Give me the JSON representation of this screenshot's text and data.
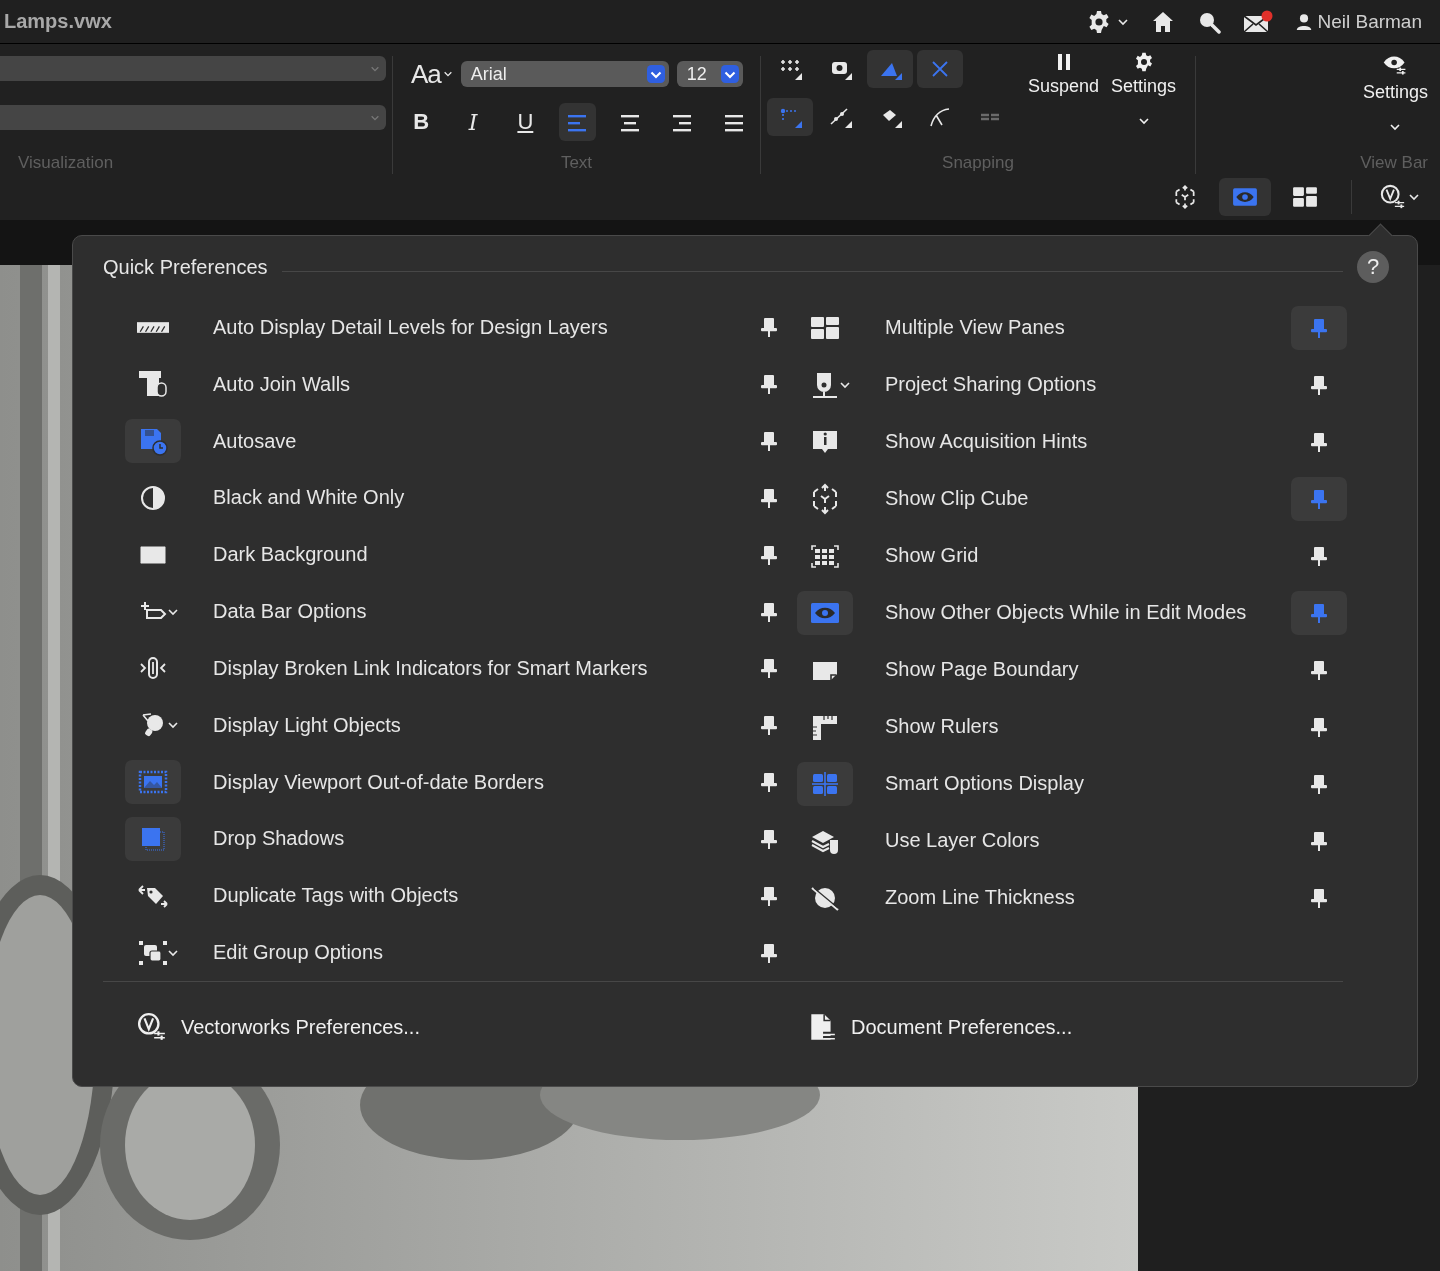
{
  "title_bar": {
    "title": "Lamps.vwx",
    "user": "Neil Barman"
  },
  "toolbar": {
    "visualization": {
      "label": "Visualization",
      "dropdowns": [
        {
          "kind": "select"
        },
        {
          "kind": "select"
        }
      ]
    },
    "text": {
      "label": "Text",
      "font_button": "Aa",
      "font": "Arial",
      "size": "12",
      "styles": [
        {
          "label": "B",
          "kind": "bold"
        },
        {
          "label": "I",
          "kind": "italic"
        },
        {
          "label": "U",
          "kind": "underline"
        }
      ],
      "alignments": [
        {
          "selected": true
        },
        {
          "selected": false
        },
        {
          "selected": false
        },
        {
          "selected": false
        }
      ]
    },
    "snapping": {
      "label": "Snapping",
      "tools": [
        {
          "selected": false,
          "disabled": false
        },
        {
          "selected": false,
          "disabled": false
        },
        {
          "selected": true,
          "disabled": false
        },
        {
          "selected": true,
          "disabled": false
        },
        {
          "selected": true,
          "disabled": false
        },
        {
          "selected": false,
          "disabled": false
        },
        {
          "selected": false,
          "disabled": false
        },
        {
          "selected": false,
          "disabled": false
        },
        {
          "selected": false,
          "disabled": true
        }
      ],
      "suspend": "Suspend",
      "settings": "Settings"
    },
    "view_bar": {
      "label": "View Bar",
      "settings": "Settings"
    },
    "view_tools": [
      {
        "selected": false
      },
      {
        "selected": true
      },
      {
        "selected": false
      }
    ]
  },
  "popup": {
    "title": "Quick Preferences",
    "help": "?",
    "items_left": [
      {
        "label": "Auto Display Detail Levels for Design Layers",
        "on": false,
        "pinned": false,
        "has_menu": false
      },
      {
        "label": "Auto Join Walls",
        "on": false,
        "pinned": false,
        "has_menu": false
      },
      {
        "label": "Autosave",
        "on": true,
        "pinned": false,
        "has_menu": false
      },
      {
        "label": "Black and White Only",
        "on": false,
        "pinned": false,
        "has_menu": false
      },
      {
        "label": "Dark Background",
        "on": false,
        "pinned": false,
        "has_menu": false
      },
      {
        "label": "Data Bar Options",
        "on": false,
        "pinned": false,
        "has_menu": true
      },
      {
        "label": "Display Broken Link Indicators for Smart Markers",
        "on": false,
        "pinned": false,
        "has_menu": false
      },
      {
        "label": "Display Light Objects",
        "on": false,
        "pinned": false,
        "has_menu": true
      },
      {
        "label": "Display Viewport Out-of-date Borders",
        "on": true,
        "pinned": false,
        "has_menu": false
      },
      {
        "label": "Drop Shadows",
        "on": true,
        "pinned": false,
        "has_menu": false
      },
      {
        "label": "Duplicate Tags with Objects",
        "on": false,
        "pinned": false,
        "has_menu": false
      },
      {
        "label": "Edit Group Options",
        "on": false,
        "pinned": false,
        "has_menu": true
      }
    ],
    "items_right": [
      {
        "label": "Multiple View Panes",
        "on": false,
        "pinned": true,
        "has_menu": false
      },
      {
        "label": "Project Sharing Options",
        "on": false,
        "pinned": false,
        "has_menu": true
      },
      {
        "label": "Show Acquisition Hints",
        "on": false,
        "pinned": false,
        "has_menu": false
      },
      {
        "label": "Show Clip Cube",
        "on": false,
        "pinned": true,
        "has_menu": false
      },
      {
        "label": "Show Grid",
        "on": false,
        "pinned": false,
        "has_menu": false
      },
      {
        "label": "Show Other Objects While in Edit Modes",
        "on": true,
        "pinned": true,
        "has_menu": false
      },
      {
        "label": "Show Page Boundary",
        "on": false,
        "pinned": false,
        "has_menu": false
      },
      {
        "label": "Show Rulers",
        "on": false,
        "pinned": false,
        "has_menu": false
      },
      {
        "label": "Smart Options Display",
        "on": true,
        "pinned": false,
        "has_menu": false
      },
      {
        "label": "Use Layer Colors",
        "on": false,
        "pinned": false,
        "has_menu": false
      },
      {
        "label": "Zoom Line Thickness",
        "on": false,
        "pinned": false,
        "has_menu": false
      }
    ],
    "footer": [
      "Vectorworks Preferences...",
      "Document Preferences..."
    ]
  }
}
